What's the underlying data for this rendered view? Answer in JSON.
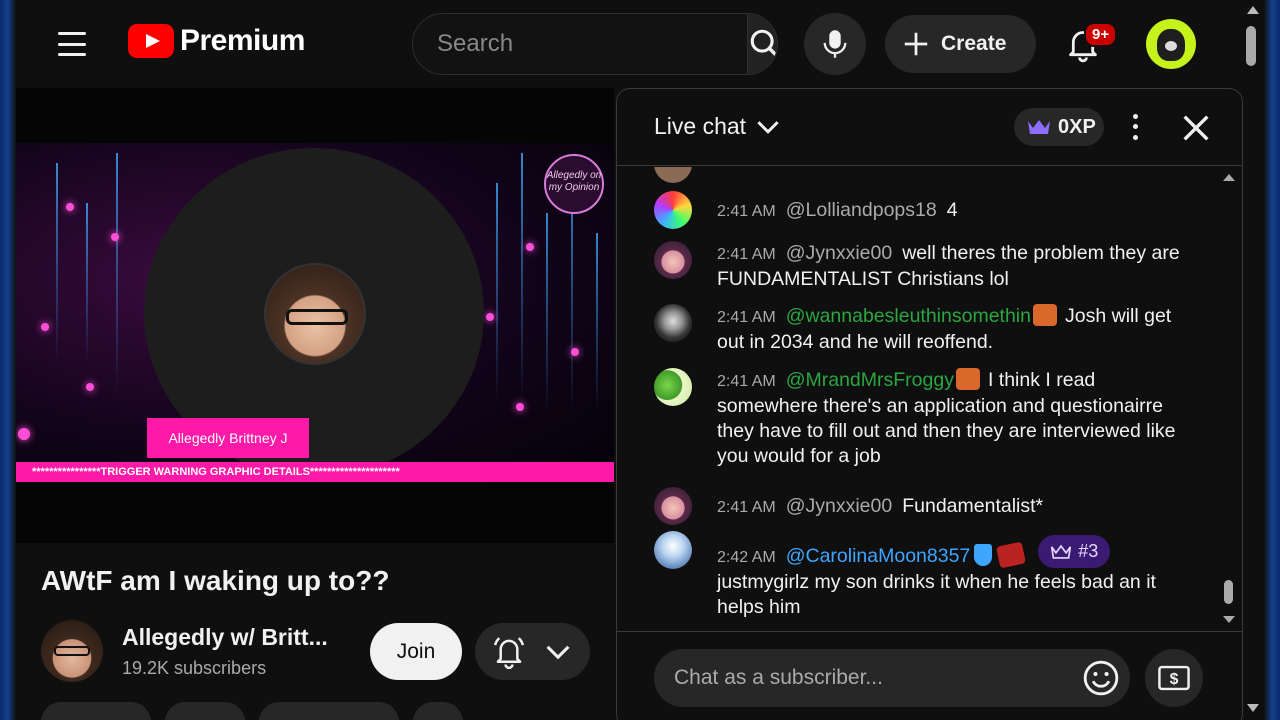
{
  "header": {
    "logo_text": "Premium",
    "search_placeholder": "Search",
    "create_label": "Create",
    "notification_badge": "9+"
  },
  "video": {
    "overlay_name": "Allegedly Brittney J",
    "warning_text": "****************TRIGGER WARNING GRAPHIC DETAILS*********************",
    "watermark": "Allegedly on my Opinion",
    "title": "AWtF am I waking up to??",
    "channel_name": "Allegedly w/ Britt...",
    "subscribers": "19.2K subscribers",
    "join_label": "Join"
  },
  "chat": {
    "title": "Live chat",
    "xp_label": "0XP",
    "input_placeholder": "Chat as a subscriber...",
    "messages": [
      {
        "time": "2:41 AM",
        "author": "@Lolliandpops18",
        "text": "4"
      },
      {
        "time": "2:41 AM",
        "author": "@Jynxxie00",
        "text": "well theres the problem they are FUNDAMENTALIST Christians lol"
      },
      {
        "time": "2:41 AM",
        "author": "@wannabesleuthinsomethin",
        "text": "Josh will get out in 2034 and he will reoffend."
      },
      {
        "time": "2:41 AM",
        "author": "@MrandMrsFroggy",
        "text": "I think I read somewhere there's an application and questionairre they have to fill out and then they are interviewed like you would for a job"
      },
      {
        "time": "2:41 AM",
        "author": "@Jynxxie00",
        "text": "Fundamentalist*"
      },
      {
        "time": "2:42 AM",
        "author": "@CarolinaMoon8357",
        "rank": "#3",
        "text": "justmygirlz my son drinks it when he feels bad an it helps him"
      }
    ]
  },
  "colors": {
    "accent_red": "#ff0000",
    "overlay_pink": "#ff19a8",
    "author_green": "#2ba640",
    "author_blue": "#3ea6ff",
    "rank_purple": "#3b1a74"
  }
}
